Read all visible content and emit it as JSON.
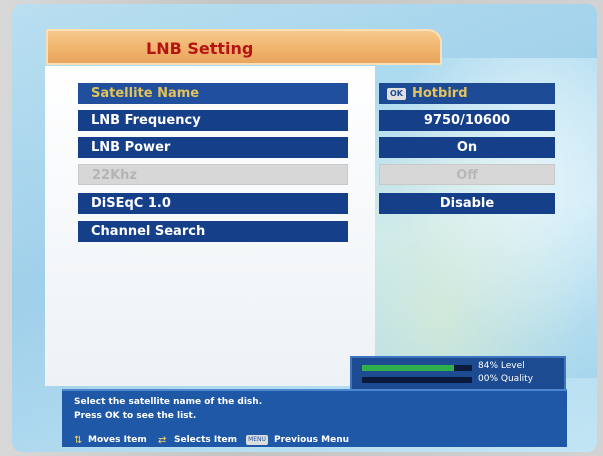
{
  "title": "LNB Setting",
  "menu": {
    "items": [
      {
        "label": "Satellite Name",
        "state": "selected"
      },
      {
        "label": "LNB Frequency",
        "state": "normal"
      },
      {
        "label": "LNB Power",
        "state": "normal"
      },
      {
        "label": "22Khz",
        "state": "disabled"
      },
      {
        "label": "DiSEqC 1.0",
        "state": "normal"
      },
      {
        "label": "Channel Search",
        "state": "normal"
      }
    ],
    "values": [
      {
        "ok_badge": "OK",
        "text": "Hotbird",
        "state": "selected"
      },
      {
        "text": "9750/10600",
        "state": "normal"
      },
      {
        "text": "On",
        "state": "normal"
      },
      {
        "text": "Off",
        "state": "disabled"
      },
      {
        "text": "Disable",
        "state": "normal"
      }
    ]
  },
  "signal": {
    "level_percent": 84,
    "level_text": "84% Level",
    "quality_percent": 0,
    "quality_text": "00% Quality",
    "level_color": "#2fb04a",
    "quality_color": "#0a1a3a"
  },
  "help": {
    "line1": "Select the satellite name of the dish.",
    "line2": "Press OK to see the list.",
    "hint_moves": "Moves Item",
    "hint_selects": "Selects Item",
    "menu_key": "MENU",
    "hint_previous": "Previous Menu"
  },
  "colors": {
    "accent_orange": "#f0b46c",
    "title_text": "#b51414",
    "item_blue": "#163f8a",
    "selected_text": "#e2c25a"
  }
}
